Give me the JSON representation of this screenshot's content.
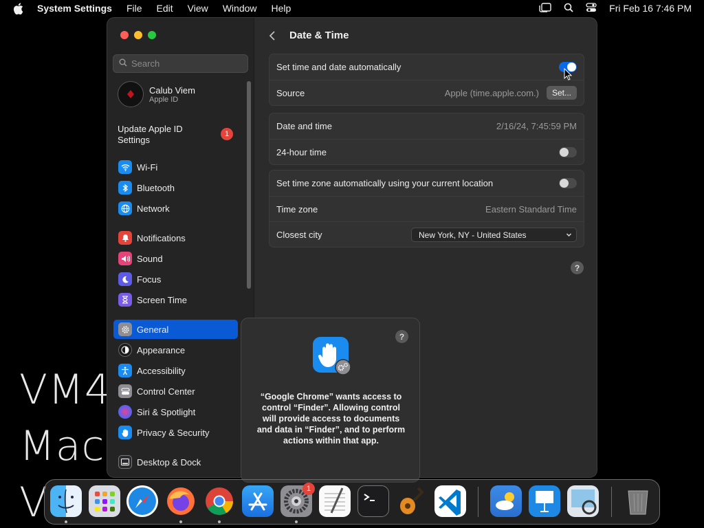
{
  "menubar": {
    "app_name": "System Settings",
    "items": [
      "File",
      "Edit",
      "View",
      "Window",
      "Help"
    ],
    "clock": "Fri Feb 16  7:46 PM"
  },
  "wallpaper": {
    "line1": "VM4",
    "line2": "MacO",
    "line3": "V"
  },
  "sidebar": {
    "search_placeholder": "Search",
    "profile": {
      "name": "Calub Viem",
      "subtitle": "Apple ID"
    },
    "update": {
      "label": "Update Apple ID Settings",
      "badge": "1"
    },
    "items": [
      {
        "label": "Wi-Fi",
        "icon": "wifi-icon",
        "color": "#1a8cf0"
      },
      {
        "label": "Bluetooth",
        "icon": "bluetooth-icon",
        "color": "#1a8cf0"
      },
      {
        "label": "Network",
        "icon": "globe-icon",
        "color": "#1a8cf0"
      },
      {
        "label": "Notifications",
        "icon": "bell-icon",
        "color": "#e5443a"
      },
      {
        "label": "Sound",
        "icon": "speaker-icon",
        "color": "#e5447a"
      },
      {
        "label": "Focus",
        "icon": "moon-icon",
        "color": "#5e5ce6"
      },
      {
        "label": "Screen Time",
        "icon": "hourglass-icon",
        "color": "#7a5ce6"
      },
      {
        "label": "General",
        "icon": "gear-icon",
        "color": "#8e8e93"
      },
      {
        "label": "Appearance",
        "icon": "appearance-icon",
        "color": "#1c1c1c"
      },
      {
        "label": "Accessibility",
        "icon": "accessibility-icon",
        "color": "#1a8cf0"
      },
      {
        "label": "Control Center",
        "icon": "control-center-icon",
        "color": "#8e8e93"
      },
      {
        "label": "Siri & Spotlight",
        "icon": "siri-icon",
        "color": "#8e44ad"
      },
      {
        "label": "Privacy & Security",
        "icon": "hand-icon",
        "color": "#1a8cf0"
      },
      {
        "label": "Desktop & Dock",
        "icon": "desktop-icon",
        "color": "#2c2c2e"
      }
    ],
    "selected": "General"
  },
  "main": {
    "title": "Date & Time",
    "group1": {
      "auto_label": "Set time and date automatically",
      "auto_on": true,
      "source_label": "Source",
      "source_value": "Apple (time.apple.com.)",
      "set_button": "Set..."
    },
    "group2": {
      "datetime_label": "Date and time",
      "datetime_value": "2/16/24, 7:45:59 PM",
      "hour24_label": "24-hour time",
      "hour24_on": false
    },
    "group3": {
      "tz_auto_label": "Set time zone automatically using your current location",
      "tz_auto_on": false,
      "tz_label": "Time zone",
      "tz_value": "Eastern Standard Time",
      "city_label": "Closest city",
      "city_value": "New York, NY - United States"
    },
    "help": "?"
  },
  "dialog": {
    "message": "“Google Chrome” wants access to control “Finder”. Allowing control will provide access to documents and data in “Finder”, and to perform actions within that app.",
    "help": "?"
  },
  "dock": {
    "apps": [
      "Finder",
      "Launchpad",
      "Safari",
      "Firefox",
      "Chrome",
      "App Store",
      "System Settings",
      "TextEdit",
      "Terminal",
      "GarageBand",
      "Visual Studio Code",
      "Weather",
      "Keynote",
      "Preview",
      "Trash"
    ],
    "settings_badge": "1"
  }
}
